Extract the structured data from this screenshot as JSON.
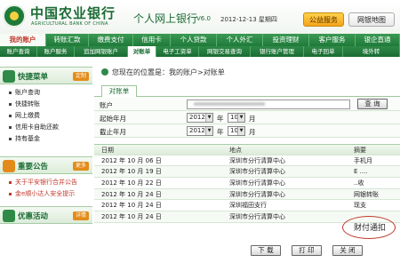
{
  "header": {
    "logo_cn": "中国农业银行",
    "logo_en": "AGRICULTURAL BANK OF CHINA",
    "title": "个人网上银行",
    "version": "V6.0",
    "datetime": "2012-12-13 星期四",
    "btn_public": "公益服务",
    "btn_sitemap": "网银地图"
  },
  "nav": [
    "我的账户",
    "转账汇款",
    "缴费支付",
    "信用卡",
    "个人贷款",
    "个人外汇",
    "投资理财",
    "客户服务",
    "银企直通"
  ],
  "subnav": [
    "账户查询",
    "账户服务",
    "追加网银账户",
    "对账单",
    "电子工资单",
    "网银交易查询",
    "银行账户管理",
    "电子回单",
    "境外转"
  ],
  "sidebar": {
    "quick_title": "快捷菜单",
    "quick_btn": "定制",
    "quick_items": [
      "账户查询",
      "快捷转账",
      "网上缴费",
      "信用卡自助还款",
      "持有基金"
    ],
    "notice_title": "重要公告",
    "notice_btn": "更多",
    "notice_items": [
      "关于平安银行合并公告",
      "金e顺小达人安全提示"
    ],
    "promo_title": "优惠活动",
    "promo_btn": "详情"
  },
  "location": "您现在的位置是：我的账户>对账单",
  "tab": "对账单",
  "form": {
    "account_label": "账户",
    "query_btn": "查 询",
    "start_label": "起始年月",
    "start_year": "2012",
    "start_month": "10",
    "end_label": "截止年月",
    "end_year": "2012",
    "end_month": "10",
    "unit_year": "年",
    "unit_month": "月"
  },
  "table": {
    "headers": [
      "日期",
      "地点",
      "摘要"
    ],
    "rows": [
      [
        "2012 年 10 月 06 日",
        "深圳市分行清算中心",
        "手机月"
      ],
      [
        "2012 年 10 月 19 日",
        "深圳市分行清算中心",
        "E ...."
      ],
      [
        "2012 年 10 月 22 日",
        "深圳市分行清算中心",
        "..收"
      ],
      [
        "2012 年 10 月 24 日",
        "深圳市分行清算中心",
        "网银转账"
      ],
      [
        "2012 年 10 月 24 日",
        "深圳福田支行",
        "现支"
      ],
      [
        "2012 年 10 月 24 日",
        "深圳市分行清算中心",
        "财付通扣"
      ]
    ]
  },
  "buttons": {
    "download": "下 载",
    "print": "打 印",
    "close": "关 闭"
  },
  "colors": {
    "brand_green": "#1a6b33",
    "accent_orange": "#f5a31a",
    "highlight_red": "#c0392b"
  }
}
